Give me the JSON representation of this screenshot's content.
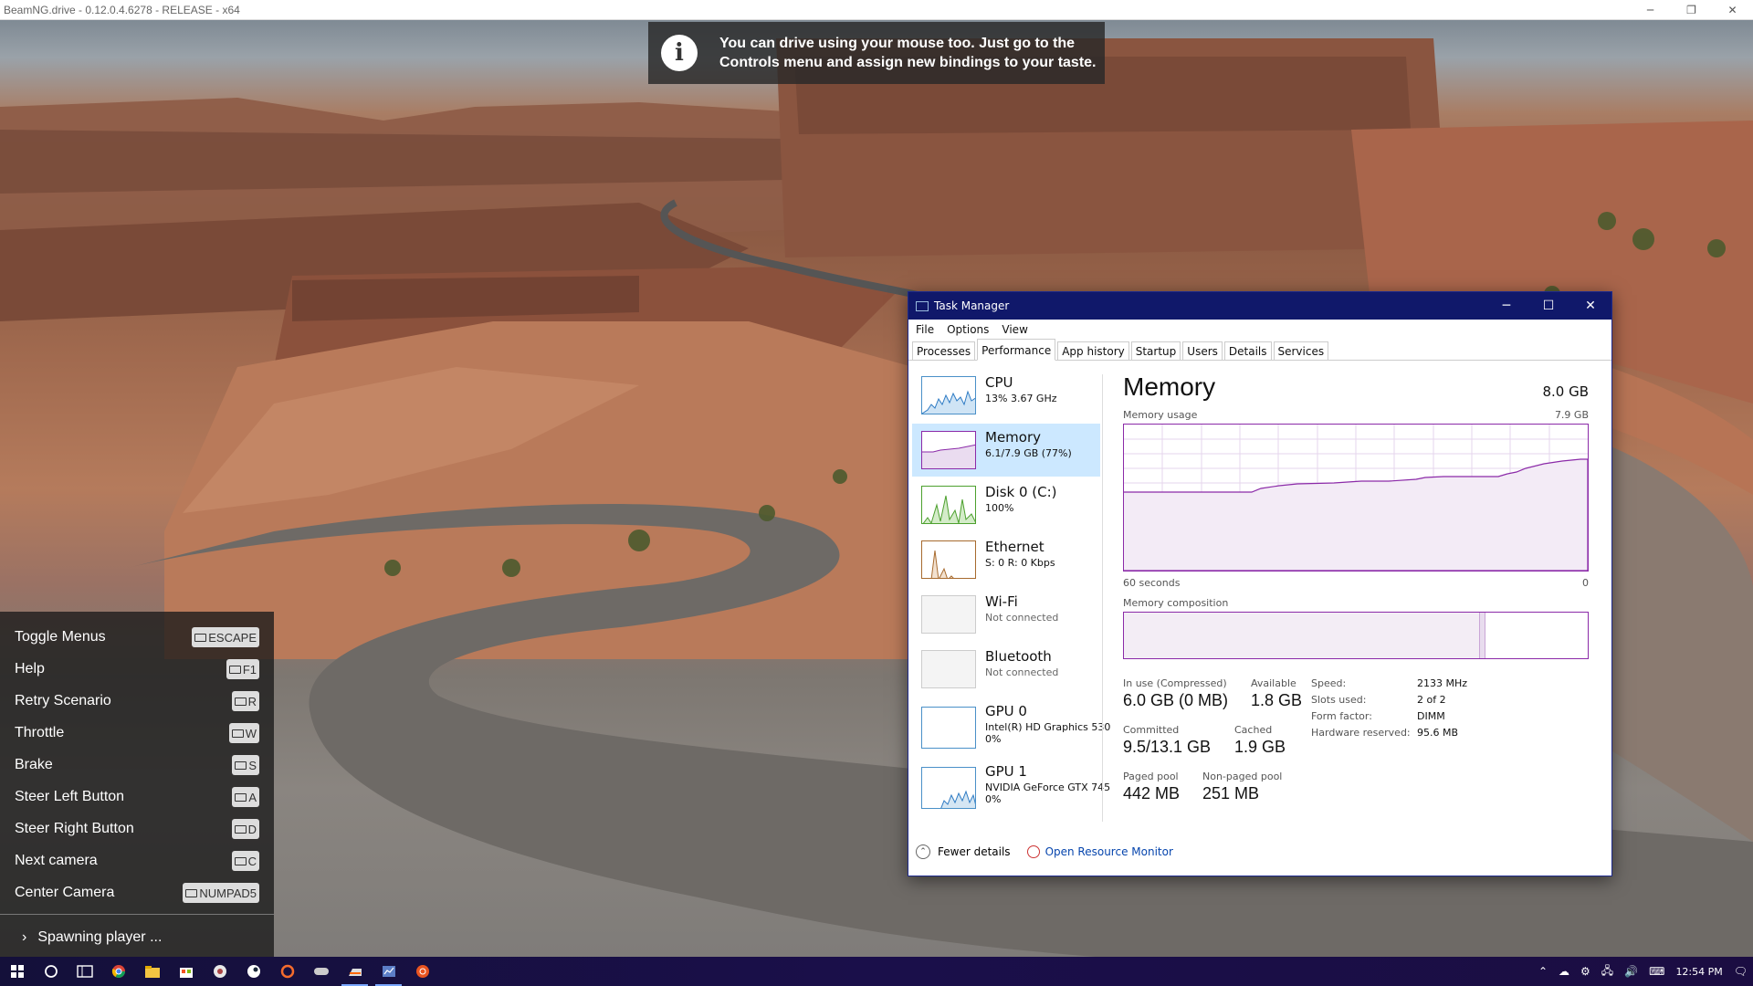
{
  "game": {
    "title": "BeamNG.drive - 0.12.0.4.6278 - RELEASE - x64",
    "minimize": "─",
    "restore": "❐",
    "close": "✕"
  },
  "toast": {
    "icon": "info-icon",
    "line1": "You can drive using your mouse too. Just go to the",
    "line2": "Controls menu and assign new bindings to your taste."
  },
  "controls": {
    "items": [
      {
        "label": "Toggle Menus",
        "key": "ESCAPE"
      },
      {
        "label": "Help",
        "key": "F1"
      },
      {
        "label": "Retry Scenario",
        "key": "R"
      },
      {
        "label": "Throttle",
        "key": "W"
      },
      {
        "label": "Brake",
        "key": "S"
      },
      {
        "label": "Steer Left Button",
        "key": "A"
      },
      {
        "label": "Steer Right Button",
        "key": "D"
      },
      {
        "label": "Next camera",
        "key": "C"
      },
      {
        "label": "Center Camera",
        "key": "NUMPAD5"
      }
    ],
    "status": "Spawning player ..."
  },
  "task_manager": {
    "title": "Task Manager",
    "menu": [
      "File",
      "Options",
      "View"
    ],
    "tabs": [
      "Processes",
      "Performance",
      "App history",
      "Startup",
      "Users",
      "Details",
      "Services"
    ],
    "active_tab": "Performance",
    "sidebar": [
      {
        "title": "CPU",
        "sub": "13%  3.67 GHz",
        "sub2": ""
      },
      {
        "title": "Memory",
        "sub": "6.1/7.9 GB (77%)",
        "sub2": ""
      },
      {
        "title": "Disk 0 (C:)",
        "sub": "100%",
        "sub2": ""
      },
      {
        "title": "Ethernet",
        "sub": "S: 0  R: 0 Kbps",
        "sub2": ""
      },
      {
        "title": "Wi-Fi",
        "sub": "Not connected",
        "sub2": ""
      },
      {
        "title": "Bluetooth",
        "sub": "Not connected",
        "sub2": ""
      },
      {
        "title": "GPU 0",
        "sub": "Intel(R) HD Graphics 530",
        "sub2": "0%"
      },
      {
        "title": "GPU 1",
        "sub": "NVIDIA GeForce GTX 745",
        "sub2": "0%"
      }
    ],
    "memory": {
      "heading": "Memory",
      "total": "8.0 GB",
      "usage_label": "Memory usage",
      "usage_max": "7.9 GB",
      "axis_left": "60 seconds",
      "axis_right": "0",
      "composition_label": "Memory composition",
      "stats": {
        "in_use_label": "In use (Compressed)",
        "in_use_value": "6.0 GB (0 MB)",
        "available_label": "Available",
        "available_value": "1.8 GB",
        "committed_label": "Committed",
        "committed_value": "9.5/13.1 GB",
        "cached_label": "Cached",
        "cached_value": "1.9 GB",
        "paged_label": "Paged pool",
        "paged_value": "442 MB",
        "nonpaged_label": "Non-paged pool",
        "nonpaged_value": "251 MB"
      },
      "details": {
        "speed_label": "Speed:",
        "speed_value": "2133 MHz",
        "slots_label": "Slots used:",
        "slots_value": "2 of 2",
        "form_label": "Form factor:",
        "form_value": "DIMM",
        "reserved_label": "Hardware reserved:",
        "reserved_value": "95.6 MB"
      }
    },
    "footer": {
      "fewer_details": "Fewer details",
      "open_monitor": "Open Resource Monitor"
    }
  },
  "taskbar": {
    "clock": "12:54 PM",
    "accent": "#7aa7ff"
  }
}
